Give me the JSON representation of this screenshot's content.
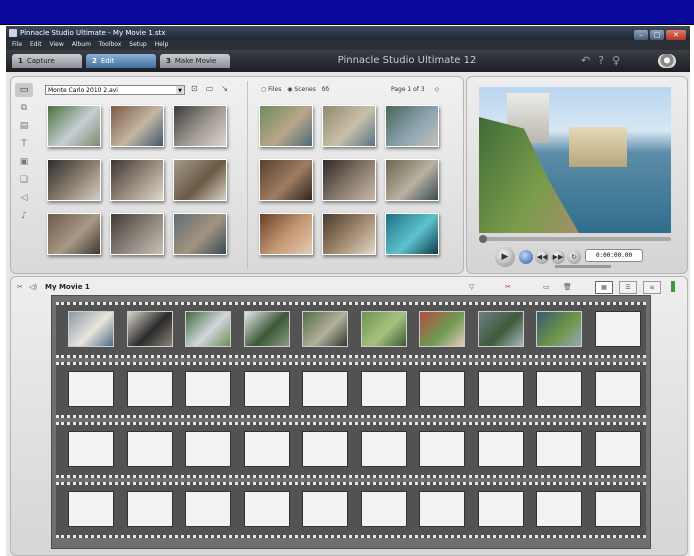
{
  "window": {
    "title": "Pinnacle Studio Ultimate - My Movie 1.stx"
  },
  "window_buttons": [
    "–",
    "□",
    "✕"
  ],
  "menu": [
    "File",
    "Edit",
    "View",
    "Album",
    "Toolbox",
    "Setup",
    "Help"
  ],
  "modes": [
    {
      "num": "1",
      "label": "Capture",
      "active": false
    },
    {
      "num": "2",
      "label": "Edit",
      "active": true
    },
    {
      "num": "3",
      "label": "Make Movie",
      "active": false
    }
  ],
  "app_title": "Pinnacle Studio Ultimate 12",
  "album": {
    "tabs": [
      "video-tab",
      "transitions-tab",
      "titles-tab",
      "text-tab",
      "photos-tab",
      "menus-tab",
      "sound-tab",
      "music-tab"
    ],
    "tab_glyphs": [
      "▭",
      "⧉",
      "▤",
      "T",
      "▣",
      "❏",
      "◁",
      "♪"
    ],
    "file_select": "Monte Carlo 2010 2.avi",
    "view_files": "Files",
    "view_scenes": "Scenes",
    "page_info": "Page 1 of 3"
  },
  "left_thumbs": [
    {
      "c1": "#4b6f3c",
      "c2": "#c5cfd4",
      "c3": "#7e8a6e"
    },
    {
      "c1": "#7a5a44",
      "c2": "#c4b7a3",
      "c3": "#3e5870"
    },
    {
      "c1": "#3b3b3b",
      "c2": "#a29c94",
      "c3": "#dcd6cd"
    },
    {
      "c1": "#2d2d2d",
      "c2": "#8e8070",
      "c3": "#d4cfc6"
    },
    {
      "c1": "#3d3733",
      "c2": "#9c8f82",
      "c3": "#e0d6cc"
    },
    {
      "c1": "#a49a88",
      "c2": "#6a5a46",
      "c3": "#d9d2c2"
    },
    {
      "c1": "#6a5a4c",
      "c2": "#a89a86",
      "c3": "#3e3631"
    },
    {
      "c1": "#3f3a36",
      "c2": "#8e877d",
      "c3": "#c9c1b6"
    },
    {
      "c1": "#5f6d76",
      "c2": "#a2947f",
      "c3": "#364b57"
    }
  ],
  "right_thumbs": [
    {
      "c1": "#6f8a5c",
      "c2": "#b8a789",
      "c3": "#4b6a7c"
    },
    {
      "c1": "#8f8a72",
      "c2": "#c9c1a7",
      "c3": "#55728b"
    },
    {
      "c1": "#4a6458",
      "c2": "#8aa3b1",
      "c3": "#c4c1b5"
    },
    {
      "c1": "#5a4130",
      "c2": "#9e7d60",
      "c3": "#2d2520"
    },
    {
      "c1": "#2f2a28",
      "c2": "#8a7b6e",
      "c3": "#c6baa9"
    },
    {
      "c1": "#6d6350",
      "c2": "#b8b1a0",
      "c3": "#3a4b54"
    },
    {
      "c1": "#6c3e2a",
      "c2": "#c79a74",
      "c3": "#e0cdb5"
    },
    {
      "c1": "#4a3b30",
      "c2": "#a48b70",
      "c3": "#e3d8c8"
    },
    {
      "c1": "#1f6f83",
      "c2": "#5ec3cf",
      "c3": "#0d3a47"
    }
  ],
  "player": {
    "timecode": "0:00:00.00"
  },
  "timeline": {
    "movie_name": "My Movie 1",
    "filled_clips": [
      {
        "c1": "#8a9aa8",
        "c2": "#e9e4db",
        "c3": "#4c6a86"
      },
      {
        "c1": "#d8d4c8",
        "c2": "#2b2b2b",
        "c3": "#8a8277"
      },
      {
        "c1": "#3e6b3a",
        "c2": "#d2d7dc",
        "c3": "#6a8e56"
      },
      {
        "c1": "#e6e8ea",
        "c2": "#3c5836",
        "c3": "#8a9c84"
      },
      {
        "c1": "#4f6e42",
        "c2": "#b3b09c",
        "c3": "#2e3a2a"
      },
      {
        "c1": "#6e9452",
        "c2": "#a7c17e",
        "c3": "#3b5a34"
      },
      {
        "c1": "#b84a4a",
        "c2": "#6d9a4f",
        "c3": "#e6c9c0"
      },
      {
        "c1": "#6c7e88",
        "c2": "#3f5a3a",
        "c3": "#a7b7be"
      },
      {
        "c1": "#355c6e",
        "c2": "#6e9448",
        "c3": "#94a8b4"
      }
    ]
  }
}
